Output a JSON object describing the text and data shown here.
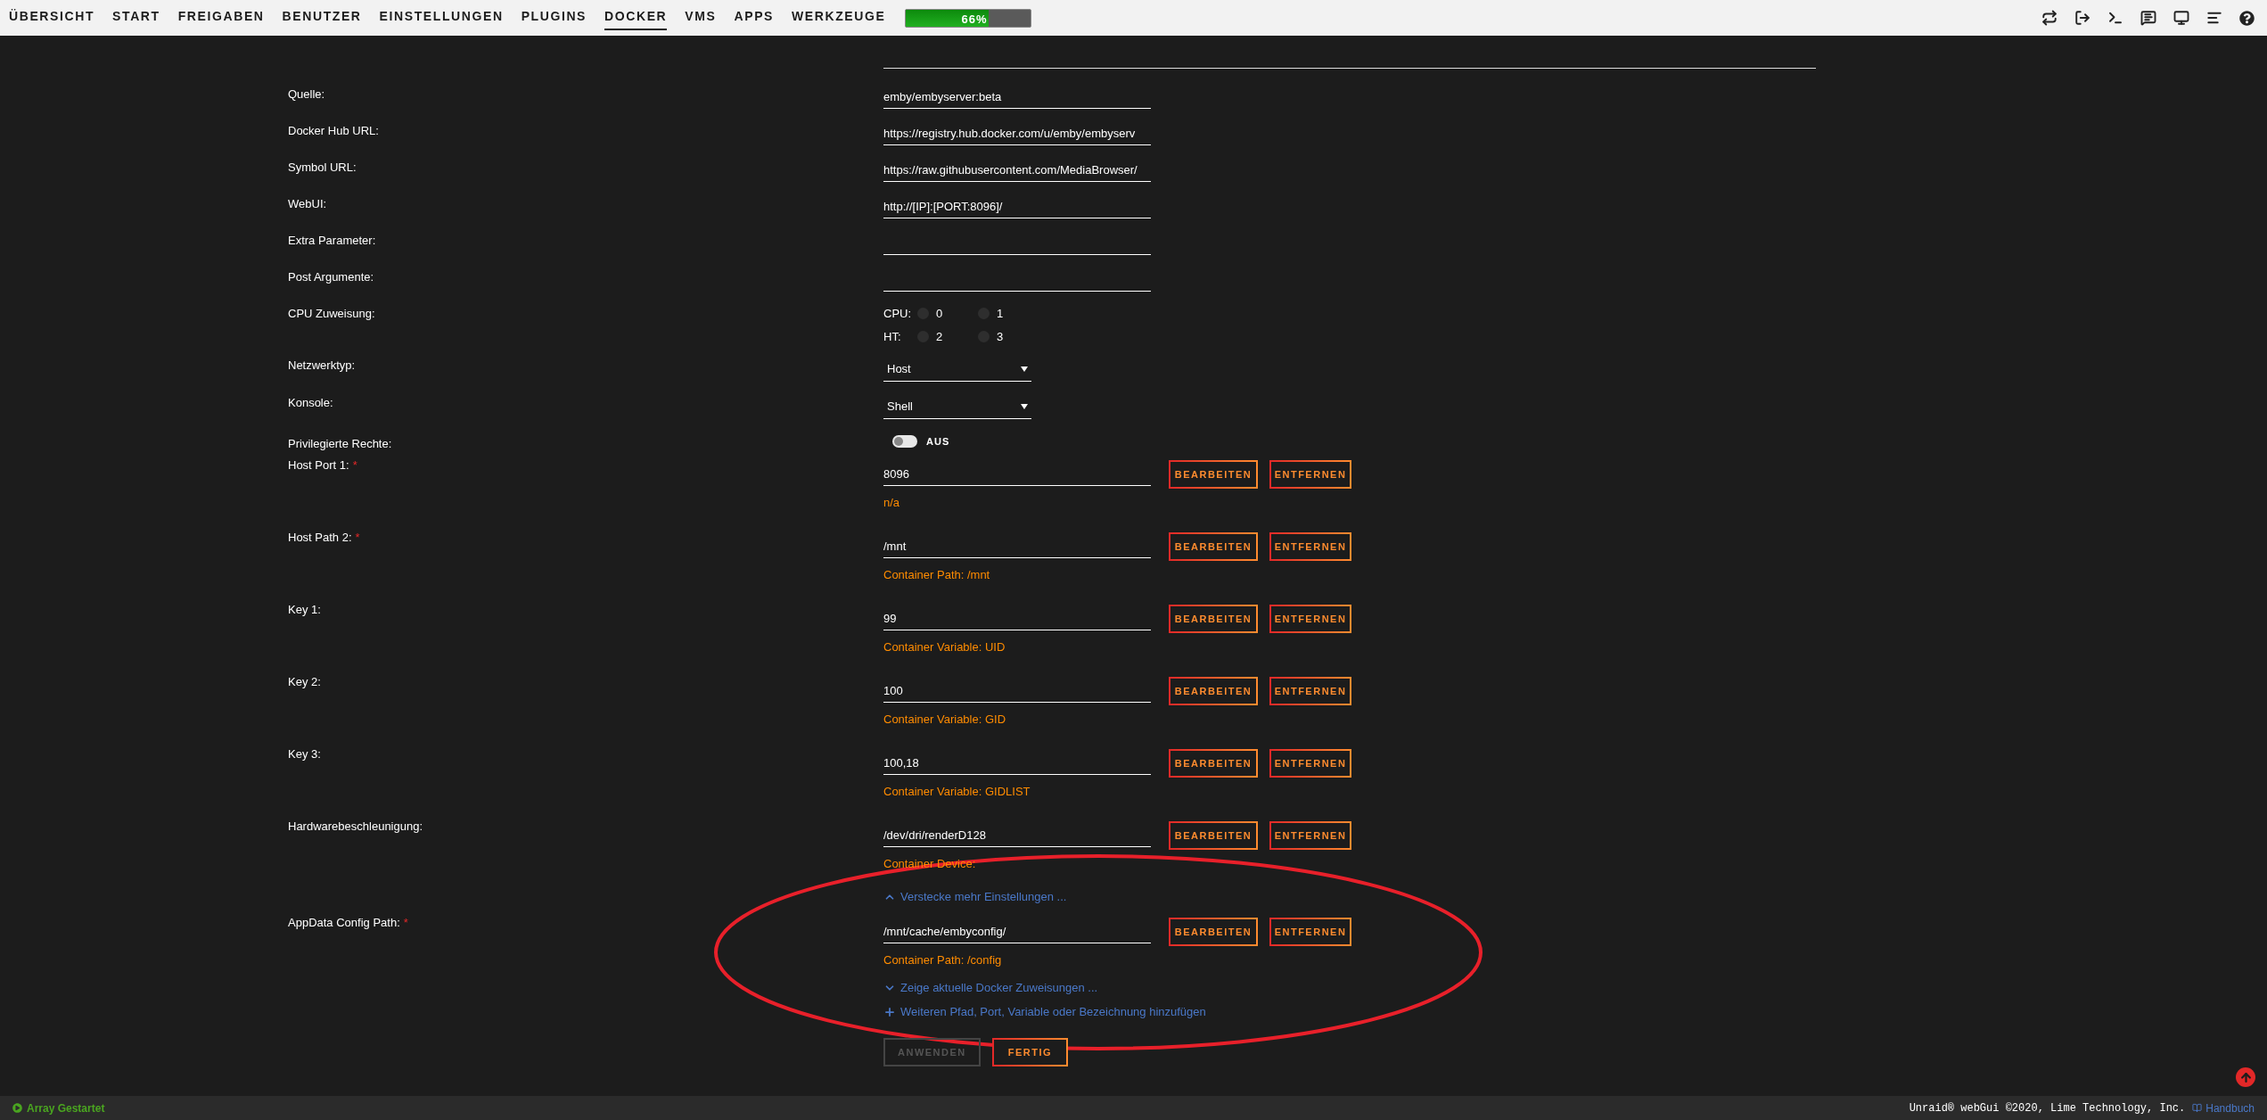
{
  "nav": {
    "tabs": [
      {
        "label": "ÜBERSICHT",
        "selected": false
      },
      {
        "label": "START",
        "selected": false
      },
      {
        "label": "FREIGABEN",
        "selected": false
      },
      {
        "label": "BENUTZER",
        "selected": false
      },
      {
        "label": "EINSTELLUNGEN",
        "selected": false
      },
      {
        "label": "PLUGINS",
        "selected": false
      },
      {
        "label": "DOCKER",
        "selected": true
      },
      {
        "label": "VMS",
        "selected": false
      },
      {
        "label": "APPS",
        "selected": false
      },
      {
        "label": "WERKZEUGE",
        "selected": false
      }
    ],
    "usage": {
      "label": "66%",
      "level": 0.66
    }
  },
  "fields": [
    {
      "kind": "text",
      "label": "Quelle:",
      "value": "emby/embyserver:beta"
    },
    {
      "kind": "text",
      "label": "Docker Hub URL:",
      "value": "https://registry.hub.docker.com/u/emby/embyserv"
    },
    {
      "kind": "text",
      "label": "Symbol URL:",
      "value": "https://raw.githubusercontent.com/MediaBrowser/"
    },
    {
      "kind": "text",
      "label": "WebUI:",
      "value": "http://[IP]:[PORT:8096]/"
    },
    {
      "kind": "text",
      "label": "Extra Parameter:"
    },
    {
      "kind": "text",
      "label": "Post Argumente:"
    },
    {
      "kind": "cpu",
      "label": "CPU Zuweisung:",
      "rows": [
        {
          "label": "CPU:",
          "cores": [
            {
              "label": "0",
              "checked": false
            },
            {
              "label": "1",
              "checked": false
            }
          ]
        },
        {
          "label": "HT:",
          "cores": [
            {
              "label": "2",
              "checked": false
            },
            {
              "label": "3",
              "checked": false
            }
          ]
        }
      ]
    },
    {
      "kind": "select",
      "label": "Netzwerktyp:",
      "value": "Host"
    },
    {
      "kind": "select",
      "label": "Konsole:",
      "value": "Shell"
    },
    {
      "kind": "switch",
      "label": "Privilegierte Rechte:",
      "on": false,
      "state_label": "AUS"
    }
  ],
  "entries": [
    {
      "label": "Host Port 1:",
      "required_mark": "*",
      "value": "8096",
      "description": "n/a",
      "edit": "BEARBEITEN",
      "remove": "ENTFERNEN"
    },
    {
      "label": "Host Path 2:",
      "required_mark": "*",
      "value": "/mnt",
      "description": "Container Path: /mnt",
      "edit": "BEARBEITEN",
      "remove": "ENTFERNEN"
    },
    {
      "label": "Key 1:",
      "value": "99",
      "description": "Container Variable: UID",
      "edit": "BEARBEITEN",
      "remove": "ENTFERNEN"
    },
    {
      "label": "Key 2:",
      "value": "100",
      "description": "Container Variable: GID",
      "edit": "BEARBEITEN",
      "remove": "ENTFERNEN"
    },
    {
      "label": "Key 3:",
      "value": "100,18",
      "description": "Container Variable: GIDLIST",
      "edit": "BEARBEITEN",
      "remove": "ENTFERNEN"
    },
    {
      "label": "Hardwarebeschleunigung:",
      "value": "/dev/dri/renderD128",
      "description": "Container Device:",
      "edit": "BEARBEITEN",
      "remove": "ENTFERNEN"
    }
  ],
  "hide_link": "Verstecke mehr Einstellungen ...",
  "config_entries": [
    {
      "label": "AppData Config Path:",
      "required_mark": "*",
      "value": "/mnt/cache/embyconfig/",
      "description": "Container Path: /config",
      "edit": "BEARBEITEN",
      "remove": "ENTFERNEN"
    }
  ],
  "show_link": "Zeige aktuelle Docker Zuweisungen ...",
  "add_link": "Weiteren Pfad, Port, Variable oder Bezeichnung hinzufügen",
  "actions": [
    {
      "label": "ANWENDEN",
      "disabled": true
    },
    {
      "label": "FERTIG",
      "disabled": false
    }
  ],
  "footer": {
    "status": "Array Gestartet",
    "copyright": "Unraid® webGui ©2020, Lime Technology, Inc.",
    "manual": "Handbuch"
  }
}
